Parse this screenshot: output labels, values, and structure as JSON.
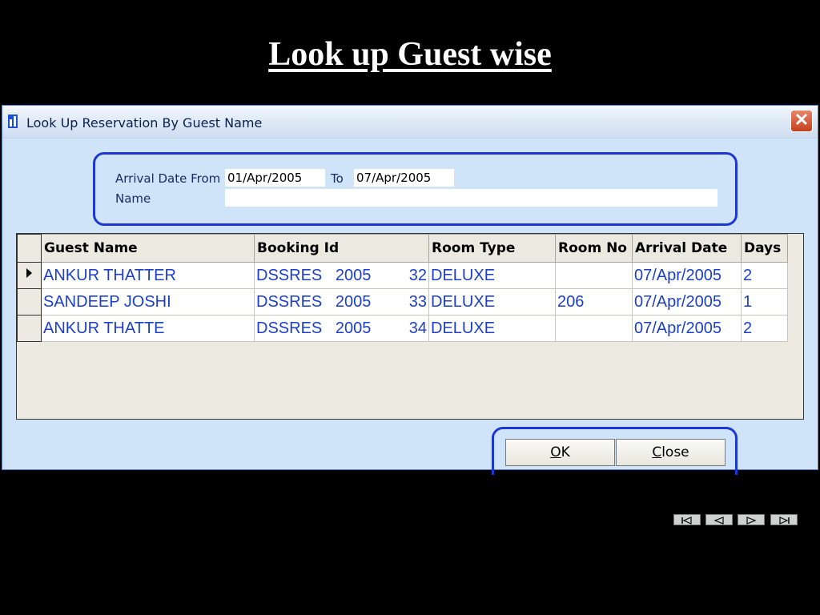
{
  "slide": {
    "title": "Look up Guest wise"
  },
  "window": {
    "title": "Look Up Reservation By Guest Name",
    "close_symbol": "✕"
  },
  "filter": {
    "arrival_from_label": "Arrival Date From",
    "arrival_from_value": "01/Apr/2005",
    "to_label": "To",
    "to_value": "07/Apr/2005",
    "name_label": "Name",
    "name_value": ""
  },
  "grid": {
    "columns": [
      "Guest Name",
      "Booking Id",
      "Room Type",
      "Room No",
      "Arrival Date",
      "Days"
    ],
    "rows": [
      {
        "selected": true,
        "guest_name": "ANKUR THATTER",
        "booking_prefix": "DSSRES   2005",
        "booking_num": "32",
        "room_type": "DELUXE",
        "room_no": "",
        "arrival_date": "07/Apr/2005",
        "days": "2"
      },
      {
        "selected": false,
        "guest_name": "SANDEEP JOSHI",
        "booking_prefix": "DSSRES   2005",
        "booking_num": "33",
        "room_type": "DELUXE",
        "room_no": "206",
        "arrival_date": "07/Apr/2005",
        "days": "1"
      },
      {
        "selected": false,
        "guest_name": "ANKUR THATTE",
        "booking_prefix": "DSSRES   2005",
        "booking_num": "34",
        "room_type": "DELUXE",
        "room_no": "",
        "arrival_date": "07/Apr/2005",
        "days": "2"
      }
    ]
  },
  "buttons": {
    "ok_mnemonic": "O",
    "ok_rest": "K",
    "close_mnemonic": "C",
    "close_rest": "lose"
  },
  "navigation": [
    "first-slide-icon",
    "previous-slide-icon",
    "next-slide-icon",
    "last-slide-icon"
  ],
  "colors": {
    "background": "#000000",
    "window_body": "#cfe3f9",
    "panel_border": "#1c37d6",
    "grid_text": "#1c3fc9",
    "close_button": "#c4401e"
  }
}
